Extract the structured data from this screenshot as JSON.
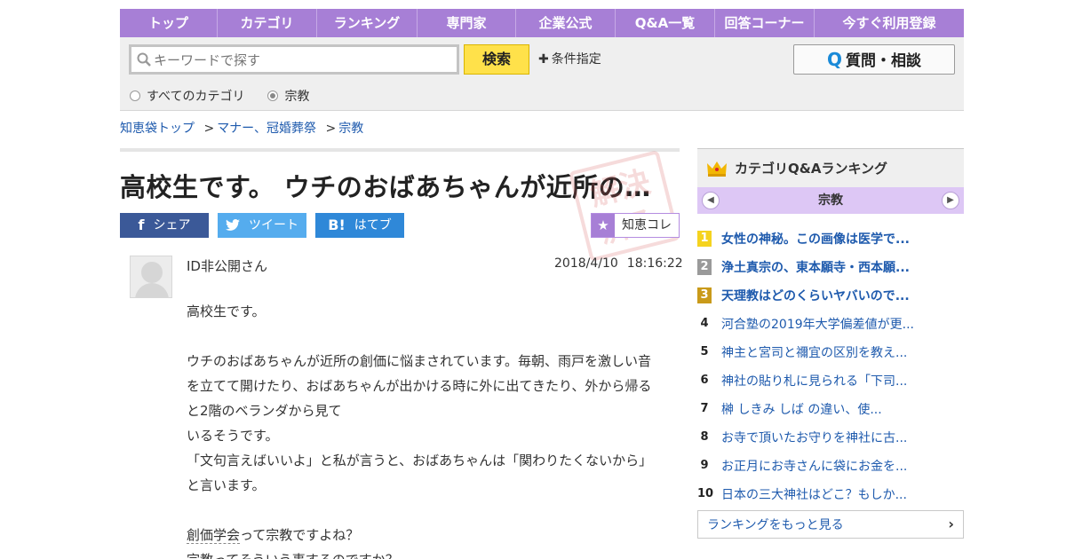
{
  "nav": {
    "items": [
      {
        "label": "トップ",
        "w": 110
      },
      {
        "label": "カテゴリ",
        "w": 112
      },
      {
        "label": "ランキング",
        "w": 113
      },
      {
        "label": "専門家",
        "w": 111
      },
      {
        "label": "企業公式",
        "w": 112
      },
      {
        "label": "Q&A一覧",
        "w": 112
      },
      {
        "label": "回答コーナー",
        "w": 112
      },
      {
        "label": "今すぐ利用登録",
        "w": 168
      }
    ]
  },
  "search": {
    "placeholder": "キーワードで探す",
    "button_label": "検索",
    "condition_label": "条件指定",
    "ask_label": "質問・相談",
    "scope_all": "すべてのカテゴリ",
    "scope_current": "宗教"
  },
  "breadcrumb": {
    "items": [
      "知恵袋トップ",
      "マナー、冠婚葬祭",
      "宗教"
    ],
    "separator": ">"
  },
  "question": {
    "title": "高校生です。 ウチのおばあちゃんが近所の創価に悩まされています。毎朝、雨戸を激しい音を立てて開けたり",
    "stamp": "解決済み",
    "share": {
      "facebook": "シェア",
      "twitter": "ツイート",
      "hatena": "はてブ",
      "hatena_mark": "B!"
    },
    "collect_label": "知恵コレ",
    "user": "ID非公開さん",
    "date": "2018/4/10",
    "time": "18:16:22",
    "body": {
      "p1": "高校生です。",
      "p2": "ウチのおばあちゃんが近所の創価に悩まされています。毎朝、雨戸を激しい音を立てて開けたり、おばあちゃんが出かける時に外に出てきたり、外から帰ると2階のベランダから見て",
      "p3": "いるそうです。",
      "p4": "「文句言えばいいよ」と私が言うと、おばあちゃんは「関わりたくないから」と言います。",
      "p5_link": "創価学会",
      "p5_rest": "って宗教ですよね？",
      "p6": "宗教ってそういう事するのですか？"
    }
  },
  "ranking": {
    "title": "カテゴリQ&Aランキング",
    "category": "宗教",
    "items": [
      {
        "rank": "1",
        "text": "女性の神秘。この画像は医学で..."
      },
      {
        "rank": "2",
        "text": "浄土真宗の、東本願寺・西本願..."
      },
      {
        "rank": "3",
        "text": "天理教はどのくらいヤバいので..."
      },
      {
        "rank": "4",
        "text": "河合塾の2019年大学偏差値が更..."
      },
      {
        "rank": "5",
        "text": "神主と宮司と禰宜の区別を教え..."
      },
      {
        "rank": "6",
        "text": "神社の貼り札に見られる「下司..."
      },
      {
        "rank": "7",
        "text": "榊 しきみ しば の違い、使..."
      },
      {
        "rank": "8",
        "text": "お寺で頂いたお守りを神社に古..."
      },
      {
        "rank": "9",
        "text": "お正月にお寺さんに袋にお金を..."
      },
      {
        "rank": "10",
        "text": "日本の三大神社はどこ？もしか..."
      }
    ],
    "more_label": "ランキングをもっと見る"
  },
  "colors": {
    "nav": "#a77fd6",
    "link": "#1e5aad",
    "search_button": "#ffe14a",
    "facebook": "#3b5998",
    "twitter": "#55acee",
    "hatena": "#2f88d8"
  }
}
